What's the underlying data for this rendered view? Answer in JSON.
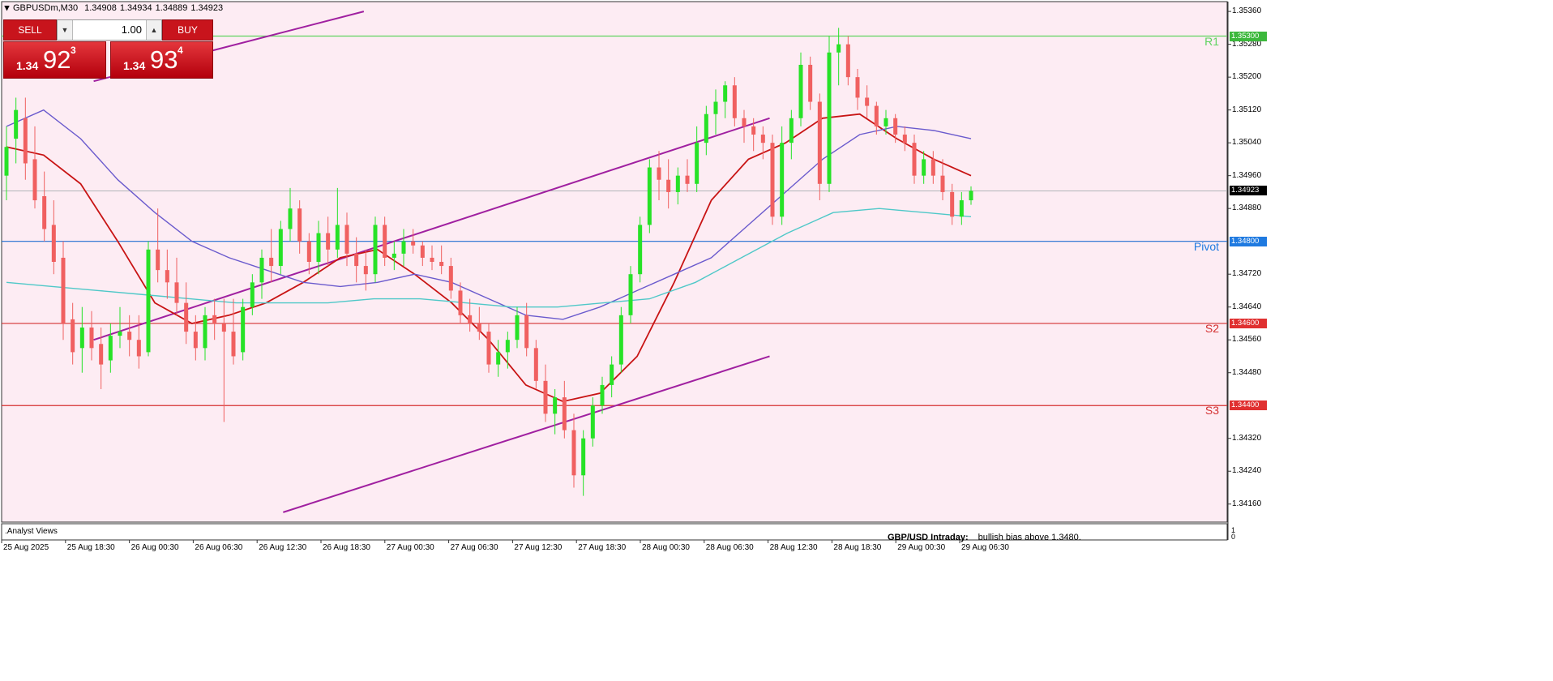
{
  "header": {
    "symbol": "GBPUSDm,M30",
    "open": "1.34908",
    "high": "1.34934",
    "low": "1.34889",
    "close": "1.34923"
  },
  "trade_panel": {
    "sell_label": "SELL",
    "buy_label": "BUY",
    "lot_value": "1.00",
    "sell_prefix": "1.34",
    "sell_big": "92",
    "sell_sup": "3",
    "buy_prefix": "1.34",
    "buy_big": "93",
    "buy_sup": "4"
  },
  "price_axis": [
    "1.35360",
    "1.35280",
    "1.35200",
    "1.35120",
    "1.35040",
    "1.34960",
    "1.34880",
    "1.34720",
    "1.34640",
    "1.34560",
    "1.34480",
    "1.34320",
    "1.34240",
    "1.34160"
  ],
  "levels": [
    {
      "name": "R1",
      "price_text": "1.35300",
      "label": "R1",
      "value": 1.353,
      "color": "#5fd35f",
      "tag_color": "#3cb83c",
      "label_color": "#5fd35f"
    },
    {
      "name": "Pivot",
      "price_text": "1.34800",
      "label": "Pivot",
      "value": 1.348,
      "color": "#1f6fd1",
      "tag_color": "#1f7ae0",
      "label_color": "#1f7ae0"
    },
    {
      "name": "S2",
      "price_text": "1.34600",
      "label": "S2",
      "value": 1.346,
      "color": "#d43030",
      "tag_color": "#e03030",
      "label_color": "#d43030"
    },
    {
      "name": "S3",
      "price_text": "1.34400",
      "label": "S3",
      "value": 1.344,
      "color": "#d43030",
      "tag_color": "#e03030",
      "label_color": "#d43030"
    }
  ],
  "current_price": {
    "text": "1.34923",
    "value": 1.34923
  },
  "time_axis": [
    "25 Aug 2025",
    "25 Aug 18:30",
    "26 Aug 00:30",
    "26 Aug 06:30",
    "26 Aug 12:30",
    "26 Aug 18:30",
    "27 Aug 00:30",
    "27 Aug 06:30",
    "27 Aug 12:30",
    "27 Aug 18:30",
    "28 Aug 00:30",
    "28 Aug 06:30",
    "28 Aug 12:30",
    "28 Aug 18:30",
    "29 Aug 00:30",
    "29 Aug 06:30"
  ],
  "footer": {
    "indicator_label": ".Analyst Views",
    "intraday_title": "GBP/USD Intraday:",
    "intraday_text": "bullish bias above 1.3480."
  },
  "sub_axis": [
    "1",
    "0"
  ],
  "colors": {
    "background": "#fdecf3",
    "bull": "#27e227",
    "bear": "#f06060",
    "ma_fast": "#c81414",
    "ma_mid": "#6a5acd",
    "ma_slow": "#4fc8c8",
    "channel": "#a020a0"
  },
  "chart_data": {
    "type": "candlestick",
    "symbol": "GBPUSDm",
    "timeframe": "M30",
    "ylim": [
      1.3412,
      1.3538
    ],
    "ohlc": [
      [
        1.3496,
        1.3508,
        1.349,
        1.3503
      ],
      [
        1.3505,
        1.3515,
        1.3499,
        1.3512
      ],
      [
        1.351,
        1.3515,
        1.3495,
        1.3499
      ],
      [
        1.35,
        1.3508,
        1.3488,
        1.349
      ],
      [
        1.3491,
        1.3497,
        1.348,
        1.3483
      ],
      [
        1.3484,
        1.349,
        1.3472,
        1.3475
      ],
      [
        1.3476,
        1.348,
        1.3456,
        1.346
      ],
      [
        1.3461,
        1.3465,
        1.345,
        1.3453
      ],
      [
        1.3454,
        1.3464,
        1.3448,
        1.3459
      ],
      [
        1.3459,
        1.3463,
        1.3451,
        1.3454
      ],
      [
        1.3455,
        1.3459,
        1.3444,
        1.345
      ],
      [
        1.3451,
        1.346,
        1.3448,
        1.3457
      ],
      [
        1.3457,
        1.3464,
        1.3454,
        1.3458
      ],
      [
        1.3458,
        1.3462,
        1.3452,
        1.3456
      ],
      [
        1.3456,
        1.3462,
        1.3449,
        1.3452
      ],
      [
        1.3453,
        1.348,
        1.3452,
        1.3478
      ],
      [
        1.3478,
        1.3488,
        1.347,
        1.3473
      ],
      [
        1.3473,
        1.3478,
        1.3466,
        1.347
      ],
      [
        1.347,
        1.3476,
        1.3462,
        1.3465
      ],
      [
        1.3465,
        1.347,
        1.3455,
        1.3458
      ],
      [
        1.3458,
        1.3462,
        1.3451,
        1.3454
      ],
      [
        1.3454,
        1.3464,
        1.3451,
        1.3462
      ],
      [
        1.3462,
        1.3466,
        1.3456,
        1.346
      ],
      [
        1.346,
        1.3466,
        1.3436,
        1.3458
      ],
      [
        1.3458,
        1.3466,
        1.345,
        1.3452
      ],
      [
        1.3453,
        1.3466,
        1.3451,
        1.3464
      ],
      [
        1.3464,
        1.3472,
        1.3462,
        1.347
      ],
      [
        1.347,
        1.3478,
        1.3466,
        1.3476
      ],
      [
        1.3476,
        1.3483,
        1.347,
        1.3474
      ],
      [
        1.3474,
        1.3485,
        1.3472,
        1.3483
      ],
      [
        1.3483,
        1.3493,
        1.348,
        1.3488
      ],
      [
        1.3488,
        1.349,
        1.3477,
        1.348
      ],
      [
        1.348,
        1.3482,
        1.3472,
        1.3475
      ],
      [
        1.3475,
        1.3485,
        1.3472,
        1.3482
      ],
      [
        1.3482,
        1.3486,
        1.3474,
        1.3478
      ],
      [
        1.3478,
        1.3493,
        1.3476,
        1.3484
      ],
      [
        1.3484,
        1.3487,
        1.3474,
        1.3477
      ],
      [
        1.3477,
        1.3481,
        1.347,
        1.3474
      ],
      [
        1.3474,
        1.3478,
        1.3468,
        1.3472
      ],
      [
        1.3472,
        1.3486,
        1.347,
        1.3484
      ],
      [
        1.3484,
        1.3486,
        1.3474,
        1.3476
      ],
      [
        1.3476,
        1.348,
        1.3473,
        1.3477
      ],
      [
        1.3477,
        1.3483,
        1.3474,
        1.348
      ],
      [
        1.348,
        1.3483,
        1.3477,
        1.3479
      ],
      [
        1.3479,
        1.348,
        1.3474,
        1.3476
      ],
      [
        1.3476,
        1.3479,
        1.3473,
        1.3475
      ],
      [
        1.3475,
        1.3479,
        1.3472,
        1.3474
      ],
      [
        1.3474,
        1.3476,
        1.3466,
        1.3468
      ],
      [
        1.3468,
        1.347,
        1.346,
        1.3462
      ],
      [
        1.3462,
        1.3466,
        1.3458,
        1.346
      ],
      [
        1.346,
        1.3464,
        1.3456,
        1.3458
      ],
      [
        1.3458,
        1.346,
        1.3448,
        1.345
      ],
      [
        1.345,
        1.3456,
        1.3447,
        1.3453
      ],
      [
        1.3453,
        1.3458,
        1.3449,
        1.3456
      ],
      [
        1.3456,
        1.3464,
        1.3454,
        1.3462
      ],
      [
        1.3462,
        1.3465,
        1.3452,
        1.3454
      ],
      [
        1.3454,
        1.3456,
        1.3444,
        1.3446
      ],
      [
        1.3446,
        1.345,
        1.3436,
        1.3438
      ],
      [
        1.3438,
        1.3444,
        1.3433,
        1.3442
      ],
      [
        1.3442,
        1.3446,
        1.3432,
        1.3434
      ],
      [
        1.3434,
        1.3438,
        1.342,
        1.3423
      ],
      [
        1.3423,
        1.3434,
        1.3418,
        1.3432
      ],
      [
        1.3432,
        1.3442,
        1.343,
        1.344
      ],
      [
        1.344,
        1.3447,
        1.3438,
        1.3445
      ],
      [
        1.3445,
        1.3452,
        1.3442,
        1.345
      ],
      [
        1.345,
        1.3464,
        1.3448,
        1.3462
      ],
      [
        1.3462,
        1.3474,
        1.346,
        1.3472
      ],
      [
        1.3472,
        1.3486,
        1.347,
        1.3484
      ],
      [
        1.3484,
        1.35,
        1.3482,
        1.3498
      ],
      [
        1.3498,
        1.3502,
        1.349,
        1.3495
      ],
      [
        1.3495,
        1.35,
        1.3488,
        1.3492
      ],
      [
        1.3492,
        1.3498,
        1.3489,
        1.3496
      ],
      [
        1.3496,
        1.35,
        1.3492,
        1.3494
      ],
      [
        1.3494,
        1.3508,
        1.3492,
        1.3504
      ],
      [
        1.3504,
        1.3513,
        1.3501,
        1.3511
      ],
      [
        1.3511,
        1.3517,
        1.3506,
        1.3514
      ],
      [
        1.3514,
        1.3519,
        1.351,
        1.3518
      ],
      [
        1.3518,
        1.352,
        1.3508,
        1.351
      ],
      [
        1.351,
        1.3512,
        1.3504,
        1.3508
      ],
      [
        1.3508,
        1.351,
        1.3502,
        1.3506
      ],
      [
        1.3506,
        1.3508,
        1.35,
        1.3504
      ],
      [
        1.3504,
        1.3506,
        1.3484,
        1.3486
      ],
      [
        1.3486,
        1.3508,
        1.3484,
        1.3504
      ],
      [
        1.3504,
        1.3512,
        1.35,
        1.351
      ],
      [
        1.351,
        1.3526,
        1.3508,
        1.3523
      ],
      [
        1.3523,
        1.3525,
        1.3512,
        1.3514
      ],
      [
        1.3514,
        1.3516,
        1.349,
        1.3494
      ],
      [
        1.3494,
        1.353,
        1.3492,
        1.3526
      ],
      [
        1.3526,
        1.3532,
        1.3518,
        1.3528
      ],
      [
        1.3528,
        1.353,
        1.3518,
        1.352
      ],
      [
        1.352,
        1.3522,
        1.3512,
        1.3515
      ],
      [
        1.3515,
        1.3518,
        1.351,
        1.3513
      ],
      [
        1.3513,
        1.3514,
        1.3506,
        1.3508
      ],
      [
        1.3508,
        1.3512,
        1.3506,
        1.351
      ],
      [
        1.351,
        1.3511,
        1.3504,
        1.3506
      ],
      [
        1.3506,
        1.3508,
        1.3502,
        1.3504
      ],
      [
        1.3504,
        1.3506,
        1.3494,
        1.3496
      ],
      [
        1.3496,
        1.3502,
        1.3494,
        1.35
      ],
      [
        1.35,
        1.3502,
        1.3494,
        1.3496
      ],
      [
        1.3496,
        1.35,
        1.349,
        1.3492
      ],
      [
        1.3492,
        1.3494,
        1.3484,
        1.3486
      ],
      [
        1.3486,
        1.3492,
        1.3484,
        1.349
      ],
      [
        1.349,
        1.34934,
        1.34889,
        1.34923
      ]
    ],
    "moving_averages": [
      {
        "color": "#c81414",
        "values": [
          1.3503,
          1.3501,
          1.3494,
          1.348,
          1.3465,
          1.346,
          1.3462,
          1.3465,
          1.347,
          1.3476,
          1.3478,
          1.3472,
          1.3465,
          1.3456,
          1.3445,
          1.3441,
          1.3443,
          1.3452,
          1.347,
          1.349,
          1.35,
          1.3504,
          1.351,
          1.3511,
          1.3505,
          1.35,
          1.3496
        ]
      },
      {
        "color": "#6a5acd",
        "values": [
          1.3508,
          1.3512,
          1.3505,
          1.3495,
          1.3487,
          1.348,
          1.3476,
          1.3473,
          1.347,
          1.3469,
          1.347,
          1.3472,
          1.347,
          1.3466,
          1.3462,
          1.3461,
          1.3464,
          1.3468,
          1.3472,
          1.3476,
          1.3484,
          1.3492,
          1.35,
          1.3506,
          1.3508,
          1.3507,
          1.3505
        ]
      },
      {
        "color": "#4fc8c8",
        "values": [
          1.347,
          1.3469,
          1.3468,
          1.3467,
          1.3466,
          1.3465,
          1.3465,
          1.3465,
          1.3466,
          1.3466,
          1.3465,
          1.3464,
          1.3464,
          1.3465,
          1.3466,
          1.347,
          1.3476,
          1.3482,
          1.3487,
          1.3488,
          1.3487,
          1.3486
        ]
      }
    ],
    "channel_lines": [
      {
        "color": "#a020a0",
        "from": [
          0.074,
          1.3519
        ],
        "to": [
          0.295,
          1.3536
        ]
      },
      {
        "color": "#a020a0",
        "from": [
          0.074,
          1.3456
        ],
        "to": [
          0.627,
          1.351
        ]
      },
      {
        "color": "#a020a0",
        "from": [
          0.229,
          1.3414
        ],
        "to": [
          0.627,
          1.3452
        ]
      }
    ]
  }
}
